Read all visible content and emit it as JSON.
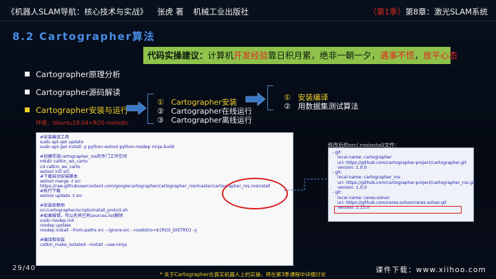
{
  "header": {
    "book_title": "《机器人SLAM导航：核心技术与实战》",
    "author": "张虎 著",
    "publisher": "机械工业出版社",
    "season": "（第1季）",
    "chapter": "第8章：激光SLAM系统"
  },
  "section_title": "8.2 Cartographer算法",
  "advice": {
    "label": "代码实操建议：",
    "part1": "计算机",
    "part2": "开发经验",
    "part3": "靠日积月累，绝非一朝一夕，",
    "part4": "遇事不慌",
    "part5": "，",
    "part6": "放平心态"
  },
  "bullets": [
    {
      "label": "Cartographer原理分析"
    },
    {
      "label": "Cartographer源码解读"
    },
    {
      "label": "Cartographer安装与运行"
    }
  ],
  "env_note": "环境：Ubuntu18.04+ROS-melodic",
  "sub_list": [
    {
      "num": "①",
      "label": "Cartographer安装"
    },
    {
      "num": "②",
      "label": "Cartographer在线运行"
    },
    {
      "num": "③",
      "label": "Cartographer离线运行"
    }
  ],
  "sub_sub_list": [
    {
      "num": "①",
      "label": "安装编译"
    },
    {
      "num": "②",
      "label": "用数据集测试算法"
    }
  ],
  "code_lines": [
    "#安装编译工具",
    "sudo apt-get update",
    "sudo apt-get install -y python-wstool python-rosdep ninja-build",
    "",
    "#创建存放cartographer_ros的专门工作空间",
    "mkdir catkin_ws_carto",
    "cd catkin_ws_carto",
    "wstool init src",
    "#下载自动安装脚本",
    "wstool merge -t src",
    "https://raw.githubusercontent.com/googlecartographer/cartographer_ros/master/cartographer_ros.rosinstall",
    "#执行下载",
    "wstool update -t src",
    "",
    "#安装依赖项",
    "src/cartographer/scripts/install_proto3.sh",
    "#如果报错，可以先将已有sources.list删除",
    "sudo rosdep init",
    "rosdep update",
    "rosdep install --from-paths src --ignore-src --rosdistro=${ROS_DISTRO} -y",
    "",
    "#编译和安装",
    "catkin_make_isolated --install --use-ninja"
  ],
  "rosinstall_label": "修改后的src/.rosinstall文件：",
  "rosinstall_lines": [
    "- git:",
    "    local-name: cartographer",
    "    uri: https://github.com/cartographer-project/cartographer.git",
    "    version: 1.0.0",
    "- git:",
    "    local-name: cartographer_ros",
    "    uri: https://github.com/cartographer-project/cartographer_ros.git",
    "    version: 1.0.0",
    "- git:",
    "    local-name: ceres-solver",
    "    uri: https://github.com/ceres-solver/ceres-solver.git",
    "    version: 1.13.0"
  ],
  "page_number": "29/40",
  "bottom_note": "* 关于Cartographer在真实机器人上的实操，将在第3季课程中详细讨论",
  "download": "课件下载：www.xiihoo.com",
  "colors": {
    "accent_blue": "#4a8ee8",
    "advice_green": "#8fc24a",
    "highlight_yellow": "#f2d22a",
    "alert_red": "#e0281e"
  }
}
